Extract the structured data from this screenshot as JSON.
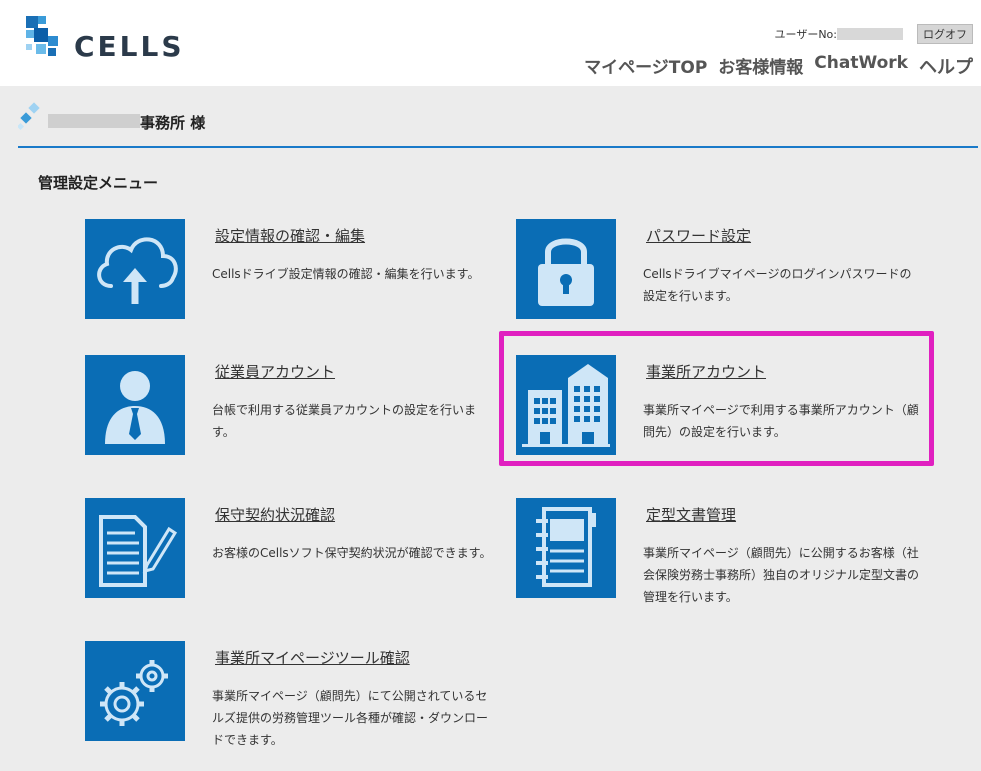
{
  "brand": {
    "logo_text": "CELLS"
  },
  "header": {
    "user_label": "ユーザーNo:",
    "logoff_label": "ログオフ",
    "nav": [
      "マイページTOP",
      "お客様情報",
      "ChatWork",
      "ヘルプ"
    ]
  },
  "office": {
    "name_suffix": "事務所 様"
  },
  "menu": {
    "title": "管理設定メニュー",
    "items": [
      {
        "icon": "cloud-upload-icon",
        "title": "設定情報の確認・編集",
        "desc": "Cellsドライブ設定情報の確認・編集を行います。"
      },
      {
        "icon": "lock-icon",
        "title": "パスワード設定",
        "desc": "Cellsドライブマイページのログインパスワードの設定を行います。"
      },
      {
        "icon": "employee-icon",
        "title": "従業員アカウント",
        "desc": "台帳で利用する従業員アカウントの設定を行います。"
      },
      {
        "icon": "building-icon",
        "title": "事業所アカウント",
        "desc": "事業所マイページで利用する事業所アカウント（顧問先）の設定を行います。"
      },
      {
        "icon": "contract-document-icon",
        "title": "保守契約状況確認",
        "desc": "お客様のCellsソフト保守契約状況が確認できます。"
      },
      {
        "icon": "notebook-icon",
        "title": "定型文書管理",
        "desc": "事業所マイページ（顧問先）に公開するお客様（社会保険労務士事務所）独自のオリジナル定型文書の管理を行います。"
      },
      {
        "icon": "gears-icon",
        "title": "事業所マイページツール確認",
        "desc": "事業所マイページ（顧問先）にて公開されているセルズ提供の労務管理ツール各種が確認・ダウンロードできます。"
      }
    ]
  },
  "colors": {
    "tile": "#0a6db5",
    "accent_line": "#1a7ac9",
    "highlight": "#e020c0"
  }
}
